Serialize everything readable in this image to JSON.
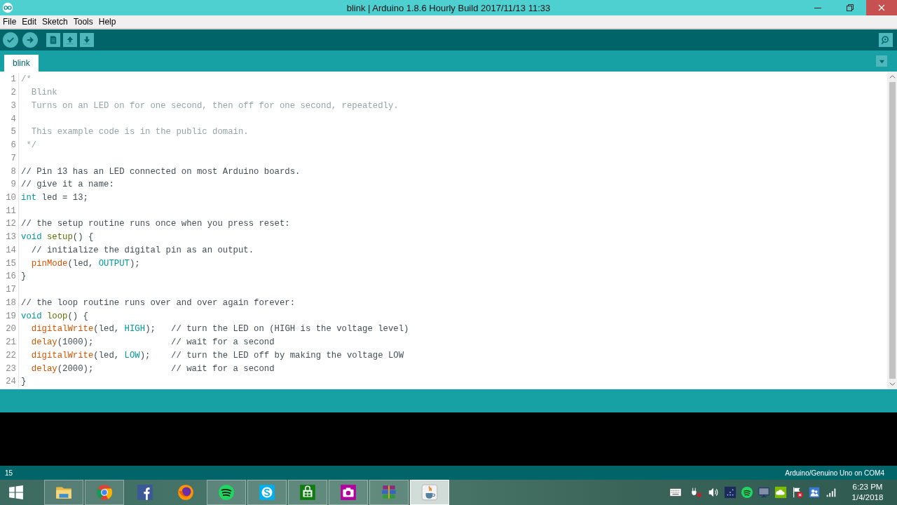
{
  "window": {
    "title": "blink | Arduino 1.8.6 Hourly Build 2017/11/13 11:33"
  },
  "menu": [
    "File",
    "Edit",
    "Sketch",
    "Tools",
    "Help"
  ],
  "toolbar": [
    {
      "kind": "verify"
    },
    {
      "kind": "upload"
    },
    {
      "kind": "new"
    },
    {
      "kind": "open"
    },
    {
      "kind": "save"
    }
  ],
  "tabs": [
    {
      "label": "blink",
      "selected": true
    }
  ],
  "editor": {
    "lines": [
      {
        "number": "1",
        "tokens": [
          {
            "kind": "block",
            "text": "/*"
          }
        ]
      },
      {
        "number": "2",
        "tokens": [
          {
            "kind": "block",
            "text": "  Blink"
          }
        ]
      },
      {
        "number": "3",
        "tokens": [
          {
            "kind": "block",
            "text": "  Turns on an LED on for one second, then off for one second, repeatedly."
          }
        ]
      },
      {
        "number": "4"
      },
      {
        "number": "5",
        "tokens": [
          {
            "kind": "block",
            "text": "  This example code is in the public domain."
          }
        ]
      },
      {
        "number": "6",
        "tokens": [
          {
            "kind": "block",
            "text": " */"
          }
        ]
      },
      {
        "number": "7"
      },
      {
        "number": "8",
        "tokens": [
          {
            "kind": "comment",
            "text": "// Pin 13 has an LED connected on most Arduino boards."
          }
        ]
      },
      {
        "number": "9",
        "tokens": [
          {
            "kind": "comment",
            "text": "// give it a name:"
          }
        ]
      },
      {
        "number": "10",
        "tokens": [
          {
            "kind": "type",
            "text": "int"
          },
          {
            "kind": "plain",
            "text": " led = 13;"
          }
        ]
      },
      {
        "number": "11"
      },
      {
        "number": "12",
        "tokens": [
          {
            "kind": "comment",
            "text": "// the setup routine runs once when you press reset:"
          }
        ]
      },
      {
        "number": "13",
        "tokens": [
          {
            "kind": "type",
            "text": "void "
          },
          {
            "kind": "entry",
            "text": "setup"
          },
          {
            "kind": "plain",
            "text": "() {"
          }
        ]
      },
      {
        "number": "14",
        "tokens": [
          {
            "kind": "comment",
            "text": "  // initialize the digital pin as an output."
          }
        ]
      },
      {
        "number": "15",
        "tokens": [
          {
            "kind": "call",
            "text": "  pinMode"
          },
          {
            "kind": "plain",
            "text": "(led, "
          },
          {
            "kind": "constant",
            "text": "OUTPUT"
          },
          {
            "kind": "plain",
            "text": ");"
          }
        ]
      },
      {
        "number": "16",
        "tokens": [
          {
            "kind": "plain",
            "text": "}"
          }
        ]
      },
      {
        "number": "17"
      },
      {
        "number": "18",
        "tokens": [
          {
            "kind": "comment",
            "text": "// the loop routine runs over and over again forever:"
          }
        ]
      },
      {
        "number": "19",
        "tokens": [
          {
            "kind": "type",
            "text": "void "
          },
          {
            "kind": "entry",
            "text": "loop"
          },
          {
            "kind": "plain",
            "text": "() {"
          }
        ]
      },
      {
        "number": "20",
        "tokens": [
          {
            "kind": "call",
            "text": "  digitalWrite"
          },
          {
            "kind": "plain",
            "text": "(led, "
          },
          {
            "kind": "constant",
            "text": "HIGH"
          },
          {
            "kind": "plain",
            "text": ");   "
          },
          {
            "kind": "comment",
            "text": "// turn the LED on (HIGH is the voltage level)"
          }
        ]
      },
      {
        "number": "21",
        "tokens": [
          {
            "kind": "call",
            "text": "  delay"
          },
          {
            "kind": "plain",
            "text": "(1000);               "
          },
          {
            "kind": "comment",
            "text": "// wait for a second"
          }
        ]
      },
      {
        "number": "22",
        "tokens": [
          {
            "kind": "call",
            "text": "  digitalWrite"
          },
          {
            "kind": "plain",
            "text": "(led, "
          },
          {
            "kind": "constant",
            "text": "LOW"
          },
          {
            "kind": "plain",
            "text": ");    "
          },
          {
            "kind": "comment",
            "text": "// turn the LED off by making the voltage LOW"
          }
        ]
      },
      {
        "number": "23",
        "tokens": [
          {
            "kind": "call",
            "text": "  delay"
          },
          {
            "kind": "plain",
            "text": "(2000);               "
          },
          {
            "kind": "comment",
            "text": "// wait for a second"
          }
        ]
      },
      {
        "number": "24",
        "tokens": [
          {
            "kind": "plain",
            "text": "}"
          }
        ]
      }
    ]
  },
  "status_bar": {
    "line": "15",
    "board": "Arduino/Genuino Uno on COM4"
  },
  "taskbar": {
    "apps": [
      {
        "kind": "folder",
        "open": true,
        "selected": false
      },
      {
        "kind": "chrome",
        "open": true,
        "selected": false
      },
      {
        "kind": "facebook",
        "open": false,
        "selected": false
      },
      {
        "kind": "firefox",
        "open": false,
        "selected": false
      },
      {
        "kind": "spotify",
        "open": true,
        "selected": false
      },
      {
        "kind": "skype",
        "open": true,
        "selected": false
      },
      {
        "kind": "store",
        "open": true,
        "selected": false
      },
      {
        "kind": "camera",
        "open": true,
        "selected": false
      },
      {
        "kind": "books",
        "open": true,
        "selected": false
      },
      {
        "kind": "java",
        "open": true,
        "selected": true
      }
    ],
    "tray": [
      {
        "kind": "keyboard"
      },
      {
        "kind": "power"
      },
      {
        "kind": "speaker"
      },
      {
        "kind": "dots"
      },
      {
        "kind": "spotify"
      },
      {
        "kind": "monitor"
      },
      {
        "kind": "cloud"
      },
      {
        "kind": "flag"
      },
      {
        "kind": "people"
      },
      {
        "kind": "signal"
      }
    ],
    "time": "6:23 PM",
    "date": "1/4/2018"
  }
}
